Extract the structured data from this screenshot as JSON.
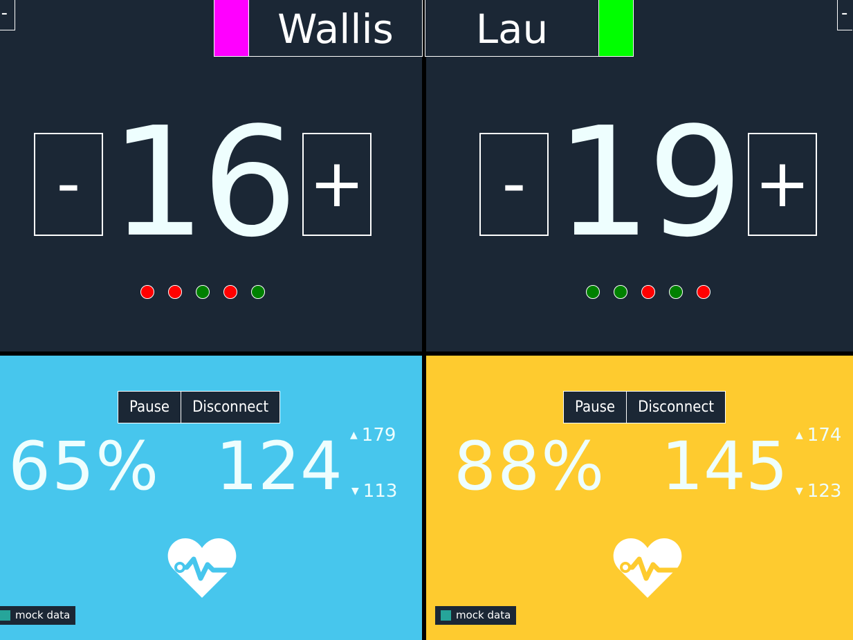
{
  "players": {
    "left": {
      "name": "Wallis",
      "color": "#ff00ff",
      "score": "16",
      "dots": [
        "red",
        "red",
        "green",
        "red",
        "green"
      ]
    },
    "right": {
      "name": "Lau",
      "color": "#00ff00",
      "score": "19",
      "dots": [
        "green",
        "green",
        "red",
        "green",
        "red"
      ]
    }
  },
  "controls": {
    "minus_label": "-",
    "plus_label": "+",
    "pause_label": "Pause",
    "disconnect_label": "Disconnect"
  },
  "edge_labels": {
    "left": "-",
    "right": "-"
  },
  "monitors": {
    "left": {
      "bg_color": "#47c6ed",
      "percent": "65%",
      "heart_rate": "124",
      "max": "179",
      "min": "113",
      "badge": "mock data"
    },
    "right": {
      "bg_color": "#fecb2f",
      "percent": "88%",
      "heart_rate": "145",
      "max": "174",
      "min": "123",
      "badge": "mock data"
    }
  },
  "icons": {
    "heart": "heart-pulse-icon",
    "up": "triangle-up-icon",
    "down": "triangle-down-icon"
  },
  "colors": {
    "panel": "#1b2735",
    "dot_red": "#ff0000",
    "dot_green": "#008000",
    "badge_swatch": "#26a59a"
  }
}
